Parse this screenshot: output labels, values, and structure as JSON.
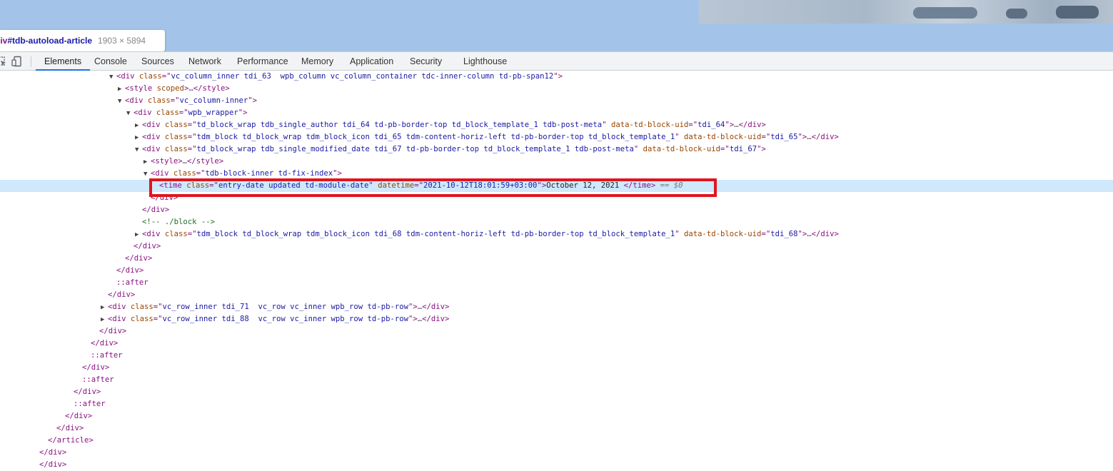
{
  "tooltip": {
    "selector_tag": "div",
    "selector_id": "#tdb-autoload-article",
    "dimensions": "1903 × 5894"
  },
  "toolbar": {
    "icons": [
      "inspect-element-icon",
      "device-toolbar-icon"
    ],
    "tabs": [
      {
        "label": "Elements",
        "active": true
      },
      {
        "label": "Console",
        "active": false
      },
      {
        "label": "Sources",
        "active": false
      },
      {
        "label": "Network",
        "active": false
      },
      {
        "label": "Performance",
        "active": false
      },
      {
        "label": "Memory",
        "active": false
      },
      {
        "label": "Application",
        "active": false
      },
      {
        "label": "Security",
        "active": false
      },
      {
        "label": "Lighthouse",
        "active": false
      }
    ]
  },
  "dom_tree": {
    "lines": [
      {
        "tri": "▼",
        "tokens": [
          [
            "t",
            "<div "
          ],
          [
            "an",
            "class"
          ],
          [
            "t",
            "=\""
          ],
          [
            "av",
            "vc_column_inner tdi_63  wpb_column vc_column_container tdc-inner-column td-pb-span12"
          ],
          [
            "t",
            "\">"
          ]
        ]
      },
      {
        "tri": "▶",
        "tokens": [
          [
            "t",
            "<style "
          ],
          [
            "an",
            "scoped"
          ],
          [
            "t",
            ">"
          ],
          [
            "ell",
            "…"
          ],
          [
            "t",
            "</style>"
          ]
        ]
      },
      {
        "tri": "▼",
        "tokens": [
          [
            "t",
            "<div "
          ],
          [
            "an",
            "class"
          ],
          [
            "t",
            "=\""
          ],
          [
            "av",
            "vc_column-inner"
          ],
          [
            "t",
            "\">"
          ]
        ]
      },
      {
        "tri": "▼",
        "tokens": [
          [
            "t",
            "<div "
          ],
          [
            "an",
            "class"
          ],
          [
            "t",
            "=\""
          ],
          [
            "av",
            "wpb_wrapper"
          ],
          [
            "t",
            "\">"
          ]
        ]
      },
      {
        "tri": "▶",
        "tokens": [
          [
            "t",
            "<div "
          ],
          [
            "an",
            "class"
          ],
          [
            "t",
            "=\""
          ],
          [
            "av",
            "td_block_wrap tdb_single_author tdi_64 td-pb-border-top td_block_template_1 tdb-post-meta"
          ],
          [
            "t",
            "\" "
          ],
          [
            "an",
            "data-td-block-uid"
          ],
          [
            "t",
            "=\""
          ],
          [
            "av",
            "tdi_64"
          ],
          [
            "t",
            "\">"
          ],
          [
            "ell",
            "…"
          ],
          [
            "t",
            "</div>"
          ]
        ]
      },
      {
        "tri": "▶",
        "tokens": [
          [
            "t",
            "<div "
          ],
          [
            "an",
            "class"
          ],
          [
            "t",
            "=\""
          ],
          [
            "av",
            "tdm_block td_block_wrap tdm_block_icon tdi_65 tdm-content-horiz-left td-pb-border-top td_block_template_1"
          ],
          [
            "t",
            "\" "
          ],
          [
            "an",
            "data-td-block-uid"
          ],
          [
            "t",
            "=\""
          ],
          [
            "av",
            "tdi_65"
          ],
          [
            "t",
            "\">"
          ],
          [
            "ell",
            "…"
          ],
          [
            "t",
            "</div>"
          ]
        ]
      },
      {
        "tri": "▼",
        "tokens": [
          [
            "t",
            "<div "
          ],
          [
            "an",
            "class"
          ],
          [
            "t",
            "=\""
          ],
          [
            "av",
            "td_block_wrap tdb_single_modified_date tdi_67 td-pb-border-top td_block_template_1 tdb-post-meta"
          ],
          [
            "t",
            "\" "
          ],
          [
            "an",
            "data-td-block-uid"
          ],
          [
            "t",
            "=\""
          ],
          [
            "av",
            "tdi_67"
          ],
          [
            "t",
            "\">"
          ]
        ]
      },
      {
        "tri": "▶",
        "tokens": [
          [
            "t",
            "<style>"
          ],
          [
            "ell",
            "…"
          ],
          [
            "t",
            "</style>"
          ]
        ]
      },
      {
        "tri": "▼",
        "tokens": [
          [
            "t",
            "<div "
          ],
          [
            "an",
            "class"
          ],
          [
            "t",
            "=\""
          ],
          [
            "av",
            "tdb-block-inner td-fix-index"
          ],
          [
            "t",
            "\">"
          ]
        ]
      },
      {
        "tri": "",
        "selected": true,
        "tokens": [
          [
            "t",
            "<time "
          ],
          [
            "an",
            "class"
          ],
          [
            "t",
            "=\""
          ],
          [
            "av",
            "entry-date updated td-module-date"
          ],
          [
            "t",
            "\" "
          ],
          [
            "an",
            "datetime"
          ],
          [
            "t",
            "=\""
          ],
          [
            "av",
            "2021-10-12T18:01:59+03:00"
          ],
          [
            "t",
            "\">"
          ],
          [
            "txt",
            "October 12, 2021 "
          ],
          [
            "t",
            "</time>"
          ],
          [
            "eq",
            " == $0"
          ]
        ]
      },
      {
        "tri": "",
        "tokens": [
          [
            "t",
            "</div>"
          ]
        ]
      },
      {
        "tri": "",
        "tokens": [
          [
            "t",
            "</div>"
          ]
        ]
      },
      {
        "tri": "",
        "tokens": [
          [
            "cm",
            "<!-- ./block -->"
          ]
        ]
      },
      {
        "tri": "▶",
        "tokens": [
          [
            "t",
            "<div "
          ],
          [
            "an",
            "class"
          ],
          [
            "t",
            "=\""
          ],
          [
            "av",
            "tdm_block td_block_wrap tdm_block_icon tdi_68 tdm-content-horiz-left td-pb-border-top td_block_template_1"
          ],
          [
            "t",
            "\" "
          ],
          [
            "an",
            "data-td-block-uid"
          ],
          [
            "t",
            "=\""
          ],
          [
            "av",
            "tdi_68"
          ],
          [
            "t",
            "\">"
          ],
          [
            "ell",
            "…"
          ],
          [
            "t",
            "</div>"
          ]
        ]
      },
      {
        "tri": "",
        "tokens": [
          [
            "t",
            "</div>"
          ]
        ]
      },
      {
        "tri": "",
        "tokens": [
          [
            "t",
            "</div>"
          ]
        ]
      },
      {
        "tri": "",
        "tokens": [
          [
            "t",
            "</div>"
          ]
        ]
      },
      {
        "tri": "",
        "tokens": [
          [
            "ps",
            "::after"
          ]
        ]
      },
      {
        "tri": "",
        "tokens": [
          [
            "t",
            "</div>"
          ]
        ]
      },
      {
        "tri": "▶",
        "tokens": [
          [
            "t",
            "<div "
          ],
          [
            "an",
            "class"
          ],
          [
            "t",
            "=\""
          ],
          [
            "av",
            "vc_row_inner tdi_71  vc_row vc_inner wpb_row td-pb-row"
          ],
          [
            "t",
            "\">"
          ],
          [
            "ell",
            "…"
          ],
          [
            "t",
            "</div>"
          ]
        ]
      },
      {
        "tri": "▶",
        "tokens": [
          [
            "t",
            "<div "
          ],
          [
            "an",
            "class"
          ],
          [
            "t",
            "=\""
          ],
          [
            "av",
            "vc_row_inner tdi_88  vc_row vc_inner wpb_row td-pb-row"
          ],
          [
            "t",
            "\">"
          ],
          [
            "ell",
            "…"
          ],
          [
            "t",
            "</div>"
          ]
        ]
      },
      {
        "tri": "",
        "tokens": [
          [
            "t",
            "</div>"
          ]
        ]
      },
      {
        "tri": "",
        "tokens": [
          [
            "t",
            "</div>"
          ]
        ]
      },
      {
        "tri": "",
        "tokens": [
          [
            "ps",
            "::after"
          ]
        ]
      },
      {
        "tri": "",
        "tokens": [
          [
            "t",
            "</div>"
          ]
        ]
      },
      {
        "tri": "",
        "tokens": [
          [
            "ps",
            "::after"
          ]
        ]
      },
      {
        "tri": "",
        "tokens": [
          [
            "t",
            "</div>"
          ]
        ]
      },
      {
        "tri": "",
        "tokens": [
          [
            "ps",
            "::after"
          ]
        ]
      },
      {
        "tri": "",
        "tokens": [
          [
            "t",
            "</div>"
          ]
        ]
      },
      {
        "tri": "",
        "tokens": [
          [
            "t",
            "</div>"
          ]
        ]
      },
      {
        "tri": "",
        "tokens": [
          [
            "t",
            "</article>"
          ]
        ]
      },
      {
        "tri": "",
        "tokens": [
          [
            "t",
            "</div>"
          ]
        ]
      },
      {
        "tri": "",
        "tokens": [
          [
            "t",
            "</div>"
          ]
        ]
      }
    ]
  },
  "colors": {
    "viewport_highlight": "#a3c4e8",
    "selected_row": "#cfe8fc",
    "annotation_box": "#e0141e",
    "active_tab_underline": "#1a73e8"
  }
}
